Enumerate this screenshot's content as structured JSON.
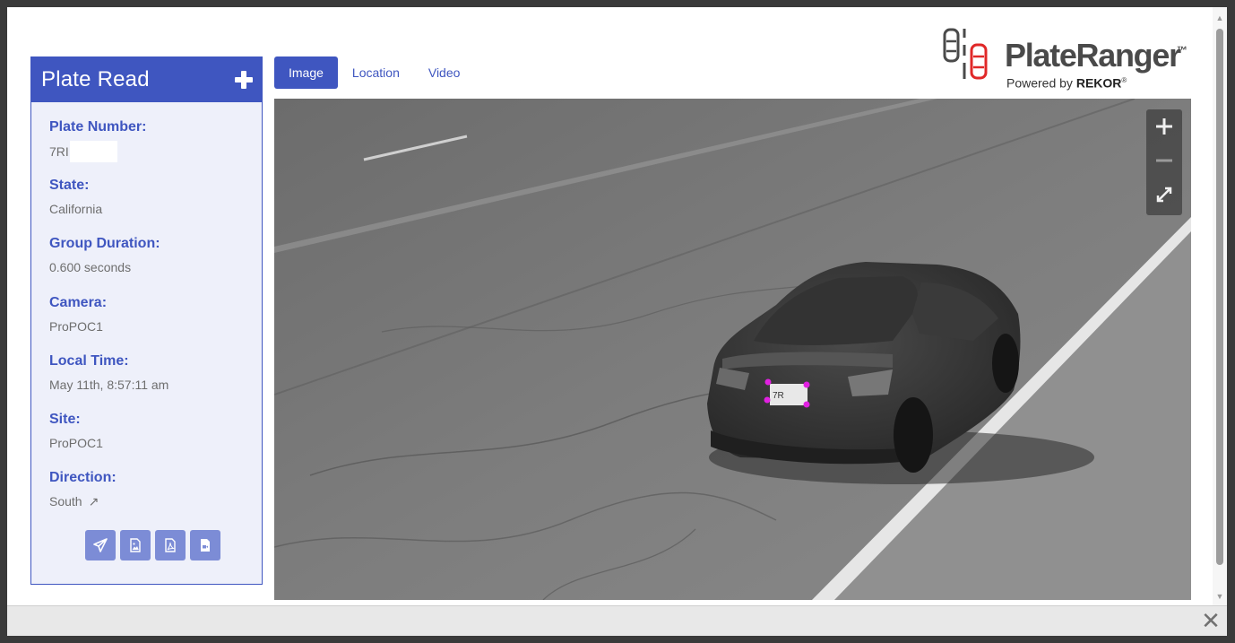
{
  "panel": {
    "title": "Plate Read",
    "fields": [
      {
        "label": "Plate Number:",
        "value": "7RI"
      },
      {
        "label": "State:",
        "value": "California"
      },
      {
        "label": "Group Duration:",
        "value": "0.600 seconds"
      },
      {
        "label": "Camera:",
        "value": "ProPOC1"
      },
      {
        "label": "Local Time:",
        "value": "May 11th, 8:57:11 am"
      },
      {
        "label": "Site:",
        "value": "ProPOC1"
      },
      {
        "label": "Direction:",
        "value": "South"
      }
    ],
    "actions": [
      "send-icon",
      "image-icon",
      "pdf-icon",
      "video-file-icon"
    ]
  },
  "tabs": [
    {
      "label": "Image",
      "active": true
    },
    {
      "label": "Location",
      "active": false
    },
    {
      "label": "Video",
      "active": false
    }
  ],
  "logo": {
    "name": "PlateRanger",
    "trademark": "™",
    "powered_by": "Powered by",
    "brand": "REKOR",
    "registered": "®"
  },
  "image": {
    "plate_text": "7R",
    "plate_marker_color": "#e020e0"
  },
  "colors": {
    "accent": "#3f56c0",
    "panel_bg": "#eef0fa",
    "action_bg": "#7c8cd6",
    "logo_red": "#e02828"
  },
  "footer": {
    "close_icon": "close-icon"
  }
}
